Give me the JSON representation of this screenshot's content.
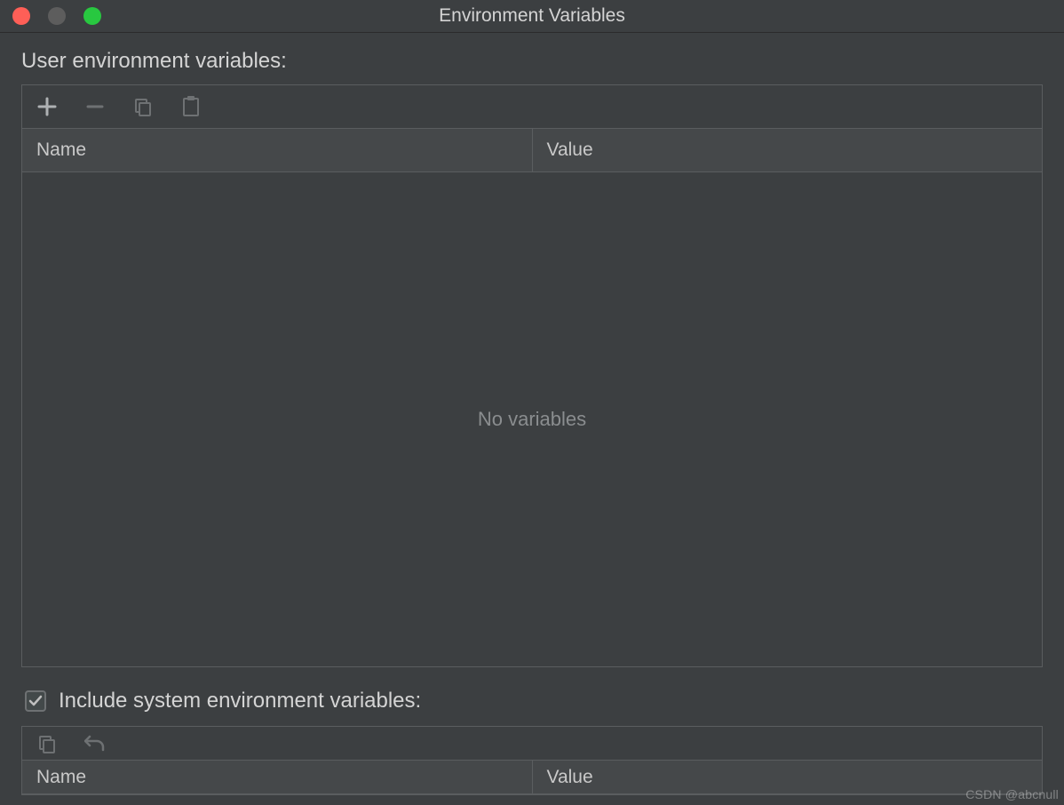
{
  "window": {
    "title": "Environment Variables"
  },
  "user_section": {
    "label": "User environment variables:",
    "columns": {
      "name": "Name",
      "value": "Value"
    },
    "empty_text": "No variables",
    "rows": []
  },
  "system_section": {
    "checkbox_label": "Include system environment variables:",
    "checked": true,
    "columns": {
      "name": "Name",
      "value": "Value"
    }
  },
  "icons": {
    "add": "plus-icon",
    "remove": "minus-icon",
    "copy": "copy-icon",
    "paste": "paste-icon",
    "copy2": "copy-icon",
    "revert": "revert-icon"
  },
  "watermark": "CSDN @abcnull"
}
